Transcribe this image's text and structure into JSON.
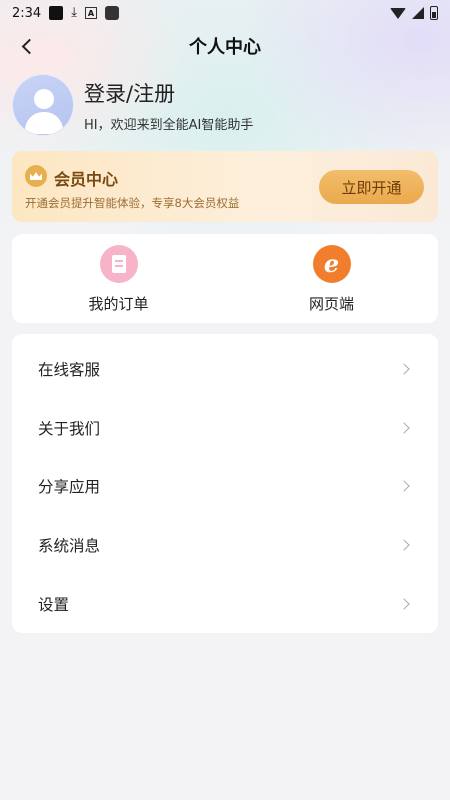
{
  "status_bar": {
    "time": "2:34"
  },
  "header": {
    "title": "个人中心"
  },
  "profile": {
    "login_text": "登录/注册",
    "welcome_text": "HI，欢迎来到全能AI智能助手"
  },
  "vip": {
    "title": "会员中心",
    "description": "开通会员提升智能体验，专享8大会员权益",
    "button_label": "立即开通"
  },
  "quick_actions": [
    {
      "label": "我的订单",
      "icon": "receipt-icon",
      "color": "#f7b4c8"
    },
    {
      "label": "网页端",
      "icon": "browser-e-icon",
      "color": "#f07e2c"
    }
  ],
  "menu": [
    {
      "label": "在线客服"
    },
    {
      "label": "关于我们"
    },
    {
      "label": "分享应用"
    },
    {
      "label": "系统消息"
    },
    {
      "label": "设置"
    }
  ],
  "colors": {
    "vip_accent": "#e7b04e",
    "vip_button": "#eaa94e",
    "avatar_bg": "#b4c3f0"
  }
}
